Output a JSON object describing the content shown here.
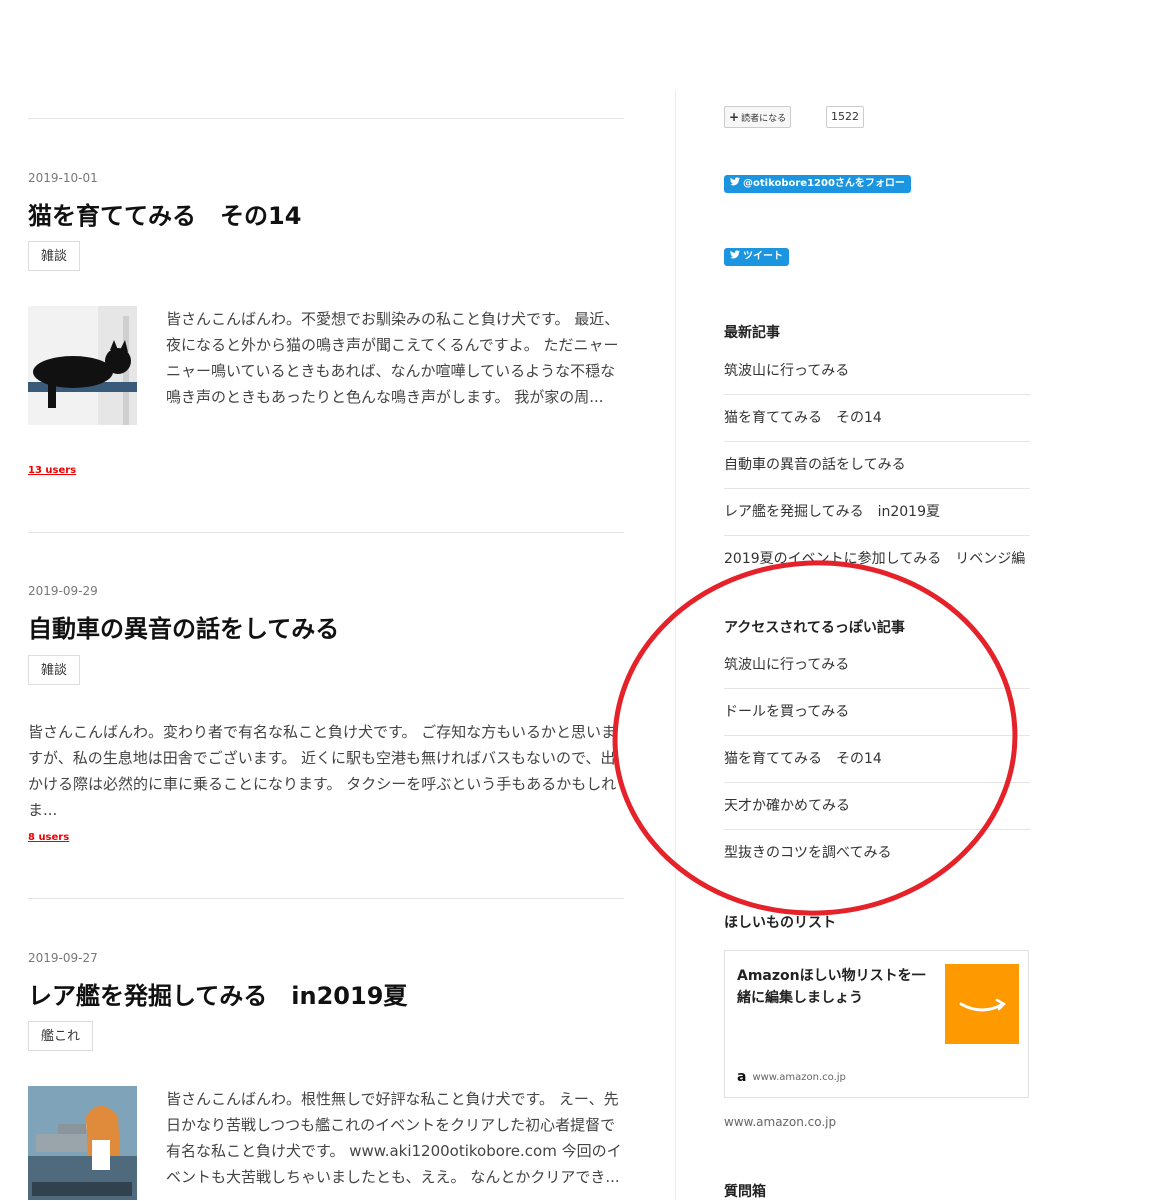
{
  "posts": [
    {
      "date": "2019-10-01",
      "title": "猫を育ててみる　その14",
      "category": "雑談",
      "excerpt": "皆さんこんばんわ。不愛想でお馴染みの私こと負け犬です。 最近、夜になると外から猫の鳴き声が聞こえてくるんですよ。 ただニャーニャー鳴いているときもあれば、なんか喧嘩しているような不穏な鳴き声のときもあったりと色んな鳴き声がします。 我が家の周...",
      "users": "13 users"
    },
    {
      "date": "2019-09-29",
      "title": "自動車の異音の話をしてみる",
      "category": "雑談",
      "excerpt": "皆さんこんばんわ。変わり者で有名な私こと負け犬です。 ご存知な方もいるかと思いますが、私の生息地は田舎でございます。 近くに駅も空港も無ければバスもないので、出かける際は必然的に車に乗ることになります。 タクシーを呼ぶという手もあるかもしれま...",
      "users": "8 users"
    },
    {
      "date": "2019-09-27",
      "title": "レア艦を発掘してみる　in2019夏",
      "category": "艦これ",
      "excerpt": "皆さんこんばんわ。根性無しで好評な私こと負け犬です。 えー、先日かなり苦戦しつつも艦これのイベントをクリアした初心者提督で有名な私こと負け犬です。 www.aki1200otikobore.com 今回のイベントも大苦戦しちゃいましたとも、ええ。 なんとかクリアでき..."
    }
  ],
  "sidebar": {
    "subscribe_label": "読者になる",
    "subscriber_count": "1522",
    "follow_label": "@otikobore1200さんをフォロー",
    "tweet_label": "ツイート",
    "latest": {
      "title": "最新記事",
      "items": [
        "筑波山に行ってみる",
        "猫を育ててみる　その14",
        "自動車の異音の話をしてみる",
        "レア艦を発掘してみる　in2019夏",
        "2019夏のイベントに参加してみる　リベンジ編"
      ]
    },
    "popular": {
      "title": "アクセスされてるっぽい記事",
      "items": [
        "筑波山に行ってみる",
        "ドールを買ってみる",
        "猫を育ててみる　その14",
        "天才か確かめてみる",
        "型抜きのコツを調べてみる"
      ]
    },
    "wishlist": {
      "title": "ほしいものリスト",
      "card_text": "Amazonほしい物リストを一緒に編集しましょう",
      "card_domain": "www.amazon.co.jp",
      "link": "www.amazon.co.jp"
    },
    "qa_title": "質問箱"
  },
  "colors": {
    "accent_red": "#e52229",
    "twitter_blue": "#1b95e0",
    "amazon_orange": "#ff9900"
  }
}
